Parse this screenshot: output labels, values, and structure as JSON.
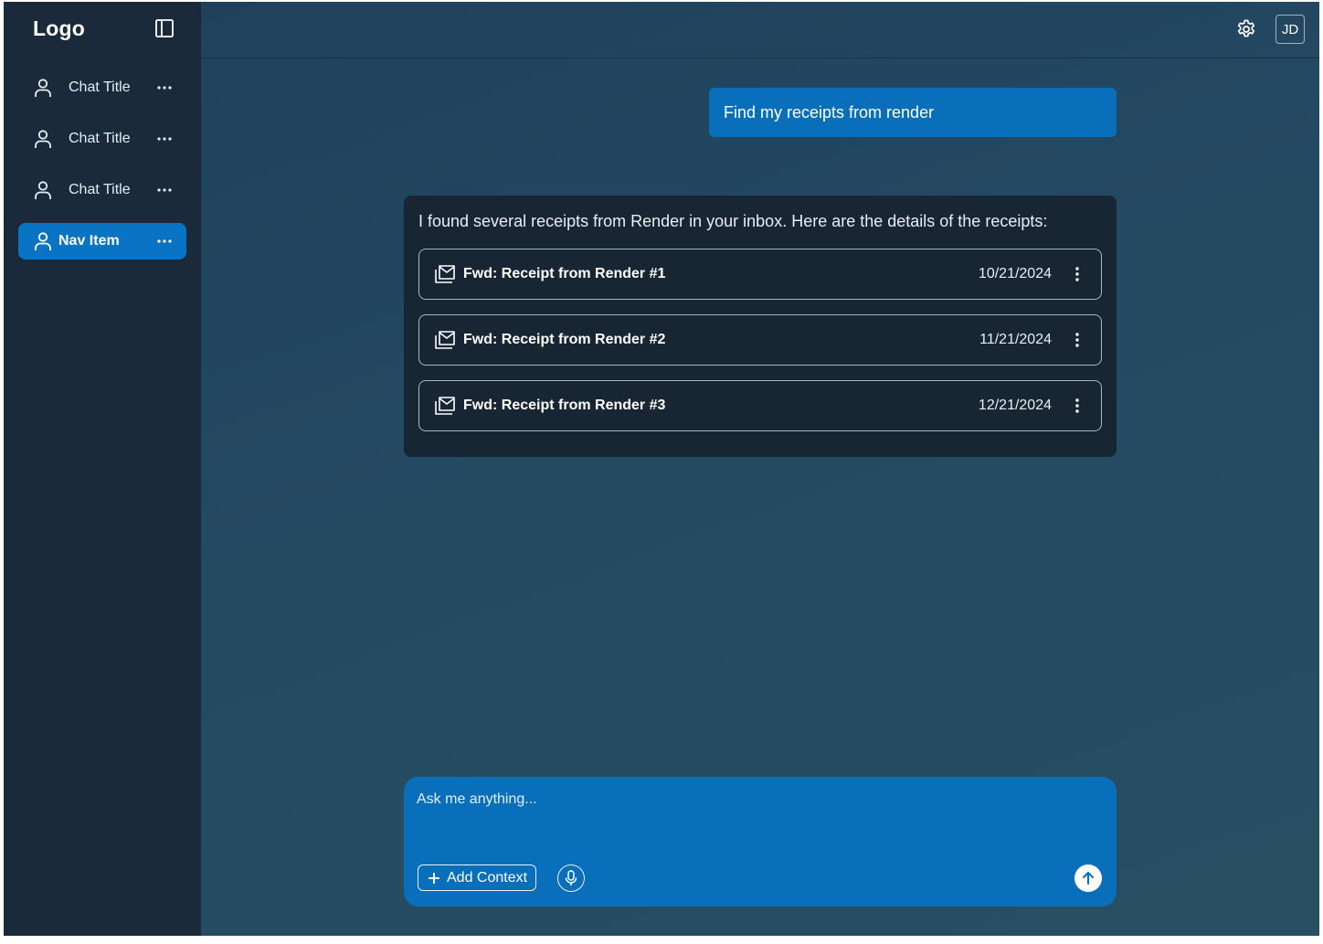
{
  "sidebar": {
    "logo": "Logo",
    "toggle_icon": "sidebar-panel-icon",
    "items": [
      {
        "label": "Chat Title",
        "icon": "user-icon",
        "active": false
      },
      {
        "label": "Chat Title",
        "icon": "user-icon",
        "active": false
      },
      {
        "label": "Chat Title",
        "icon": "user-icon",
        "active": false
      },
      {
        "label": "Nav Item",
        "icon": "user-icon",
        "active": true
      }
    ]
  },
  "header": {
    "settings_icon": "gear-icon",
    "avatar_initials": "JD"
  },
  "conversation": {
    "user_message": "Find my receipts from render",
    "assistant_message": "I found several receipts from Render in your inbox. Here are the details of the receipts:",
    "receipts": [
      {
        "subject": "Fwd: Receipt from Render #1",
        "date": "10/21/2024"
      },
      {
        "subject": "Fwd: Receipt from Render #2",
        "date": "11/21/2024"
      },
      {
        "subject": "Fwd: Receipt from Render #3",
        "date": "12/21/2024"
      }
    ]
  },
  "composer": {
    "placeholder": "Ask me anything...",
    "add_context_label": "Add Context"
  },
  "colors": {
    "sidebar_bg": "#1b2a3b",
    "accent": "#0a74c4",
    "card_bg": "#182633"
  }
}
